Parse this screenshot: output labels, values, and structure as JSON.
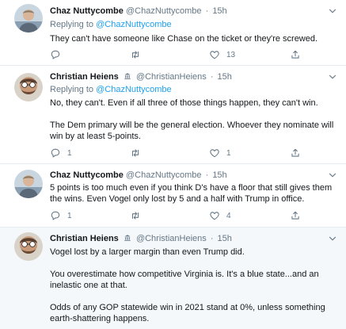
{
  "tweets": [
    {
      "name": "Chaz Nuttycombe",
      "handle": "@ChazNuttycombe",
      "sep": "·",
      "time": "15h",
      "replying_prefix": "Replying to",
      "replying_to": "@ChazNuttycombe",
      "lines": [
        "They can't have someone like Chase on the ticket or they're screwed."
      ],
      "reply_count": "",
      "retweet_count": "",
      "like_count": "13"
    },
    {
      "name": "Christian Heiens",
      "handle": "@ChristianHeiens",
      "sep": "·",
      "time": "15h",
      "replying_prefix": "Replying to",
      "replying_to": "@ChazNuttycombe",
      "lines": [
        "No, they can't. Even if all three of those things happen, they can't win.",
        "The Dem primary will be the general election. Whoever they nominate will",
        "win by at least 5-points."
      ],
      "reply_count": "1",
      "retweet_count": "",
      "like_count": "1"
    },
    {
      "name": "Chaz Nuttycombe",
      "handle": "@ChazNuttycombe",
      "sep": "·",
      "time": "15h",
      "lines": [
        "5 points is too much even if you think D's have a floor that still gives them",
        "the wins. Even Vogel only lost by 5 and a half with Trump in office."
      ],
      "reply_count": "1",
      "retweet_count": "",
      "like_count": "4"
    },
    {
      "name": "Christian Heiens",
      "handle": "@ChristianHeiens",
      "sep": "·",
      "time": "15h",
      "lines": [
        "Vogel lost by a larger margin than even Trump did.",
        "You overestimate how competitive Virginia is. It's a blue state...and an",
        "inelastic one at that.",
        "Odds of any GOP statewide win in 2021 stand at 0%, unless something",
        "earth-shattering happens."
      ]
    }
  ],
  "icons": {
    "reply": "reply-icon",
    "retweet": "retweet-icon",
    "like": "heart-icon",
    "share": "share-icon",
    "verified": "government-building-icon",
    "more": "chevron-down-icon"
  },
  "colors": {
    "link": "#1da1f2",
    "secondary": "#657786",
    "text": "#14171a",
    "divider": "#e6ecf0",
    "highlight_bg": "#f5f8fa"
  }
}
